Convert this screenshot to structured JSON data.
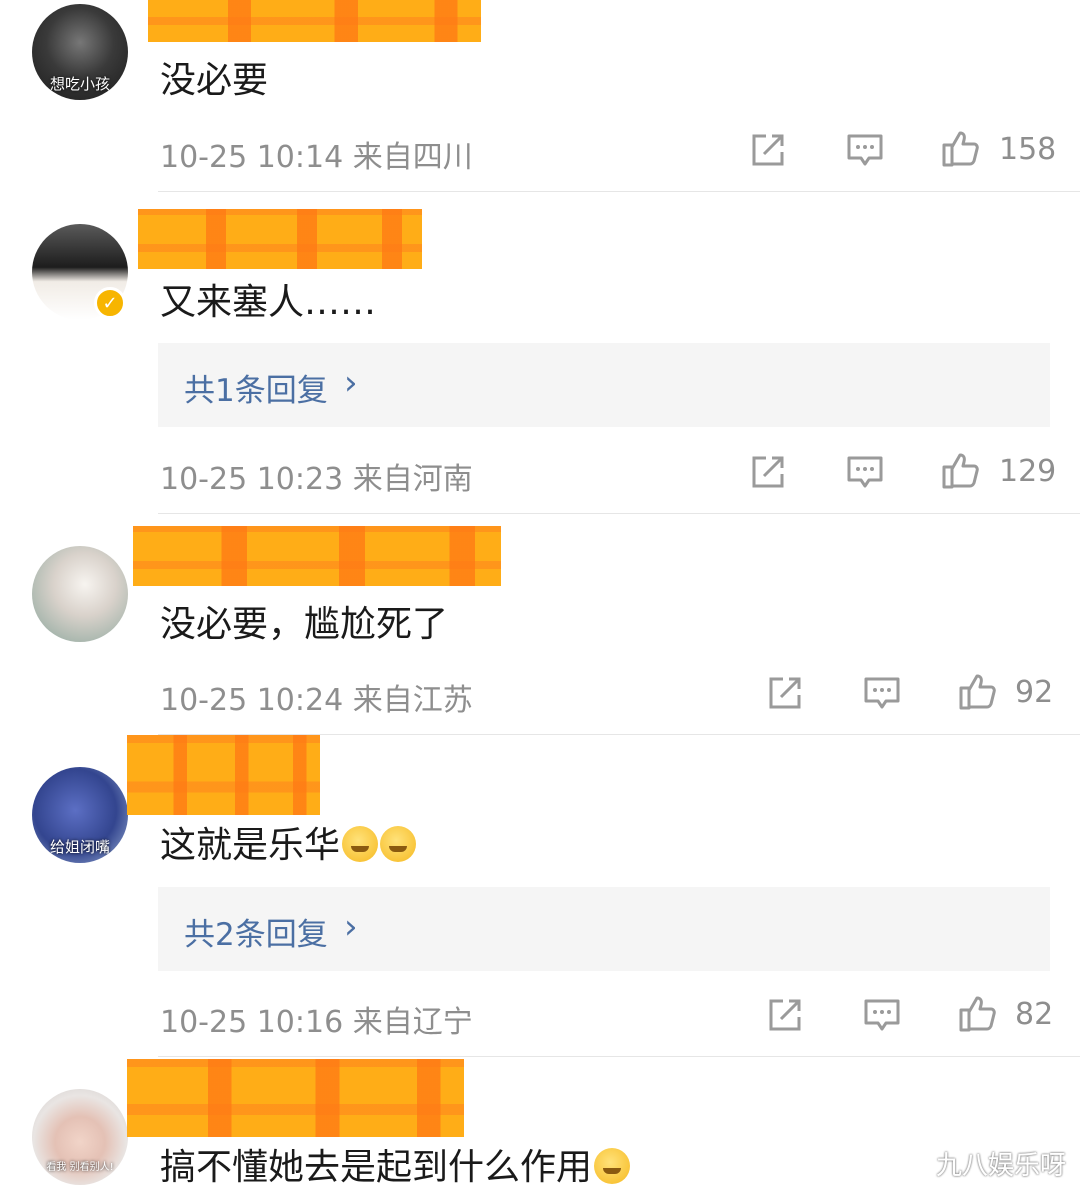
{
  "comments": [
    {
      "avatar_caption": "想吃小孩",
      "text": "没必要",
      "time": "10-25 10:14",
      "location": "来自四川",
      "likes": "158",
      "reply": ""
    },
    {
      "avatar_caption": "",
      "text": "又来塞人……",
      "time": "10-25 10:23",
      "location": "来自河南",
      "likes": "129",
      "reply": "共1条回复",
      "verified": true
    },
    {
      "avatar_caption": "",
      "text": "没必要，尴尬死了",
      "time": "10-25 10:24",
      "location": "来自江苏",
      "likes": "92",
      "reply": ""
    },
    {
      "avatar_caption": "给姐闭嘴",
      "text": "这就是乐华",
      "time": "10-25 10:16",
      "location": "来自辽宁",
      "likes": "82",
      "reply": "共2条回复"
    },
    {
      "avatar_caption": "看我 别看别人!",
      "text": "搞不懂她去是起到什么作用",
      "time": "",
      "location": "",
      "likes": "",
      "reply": ""
    }
  ],
  "icons": {
    "share": "share-icon",
    "comment": "comment-icon",
    "like": "thumbs-up-icon",
    "emoji_sleepy": "sleepy-face-emoji",
    "emoji_laugh": "laughing-tears-emoji"
  },
  "colors": {
    "link_blue": "#4b6fa3",
    "meta_gray": "#8e8e8e",
    "mosaic_orange": "#ffad17"
  },
  "watermark": "九八娱乐呀"
}
